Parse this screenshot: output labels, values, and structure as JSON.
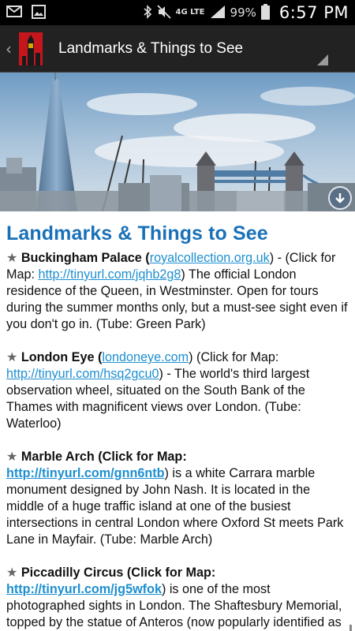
{
  "status_bar": {
    "battery": "99%",
    "time": "6:57 PM",
    "network": "4G LTE"
  },
  "action_bar": {
    "title": "Landmarks & Things to See"
  },
  "page": {
    "heading": "Landmarks & Things to See",
    "entries": [
      {
        "name": "Buckingham Palace",
        "pre_link": " (",
        "site": "royalcollection.org.uk",
        "mid": ") - (Click for Map: ",
        "map_link": "http://tinyurl.com/jqhb2g8",
        "desc": ") The official London residence of the Queen, in Westminster. Open for tours during the summer months only, but a must-see sight even if you don't go in. (Tube: Green Park)"
      },
      {
        "name": "London Eye",
        "pre_link": " (",
        "site": "londoneye.com",
        "mid": ") (Click for Map: ",
        "map_link": "http://tinyurl.com/hsq2gcu0",
        "desc": ") - The world's third largest observation wheel, situated on the South Bank of the Thames with magnificent views over London. (Tube: Waterloo)"
      },
      {
        "name": "Marble Arch (Click for Map: ",
        "map_link": "http://tinyurl.com/gnn6ntb",
        "desc": ") is a white Carrara marble monument designed by John Nash. It is located in the middle of a huge traffic island at one of the busiest intersections in central London where Oxford St meets Park Lane in Mayfair. (Tube: Marble Arch)"
      },
      {
        "name": "Piccadilly Circus (Click for Map: ",
        "map_link": "http://tinyurl.com/jg5wfok",
        "desc": ") is one of the most photographed sights in London. The Shaftesbury Memorial, topped by the statue of Anteros (now popularly identified as Eros), stands proudly in the middle of Piccadilly Circus while"
      }
    ]
  },
  "colors": {
    "heading": "#1a71b8",
    "link": "#1d8fd0",
    "actionbar": "#222222"
  }
}
